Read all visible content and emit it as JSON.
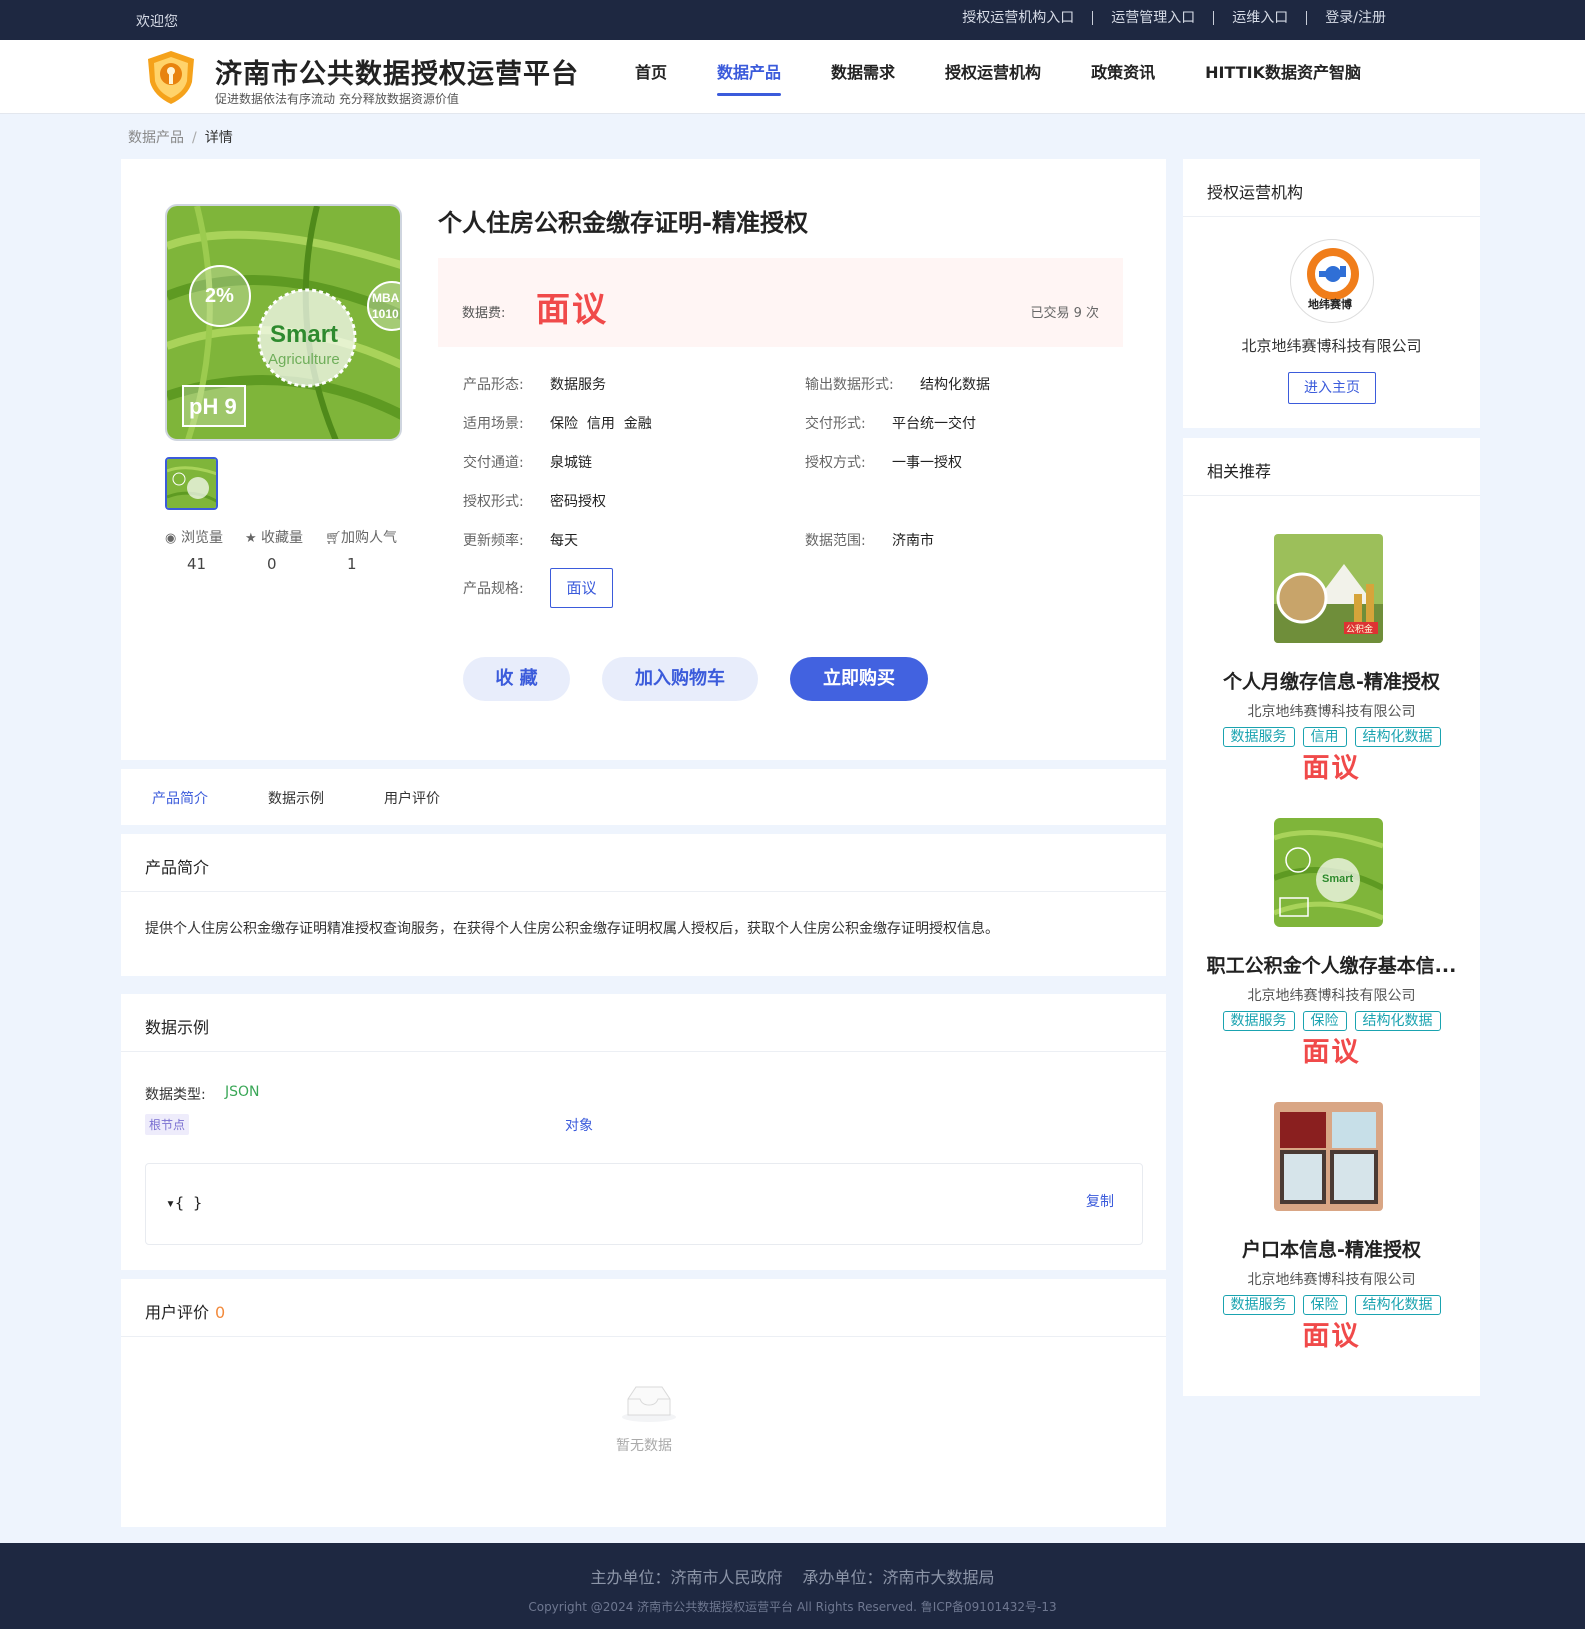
{
  "topbar": {
    "welcome": "欢迎您",
    "links": [
      "授权运营机构入口",
      "运营管理入口",
      "运维入口",
      "登录/注册"
    ]
  },
  "header": {
    "title": "济南市公共数据授权运营平台",
    "slogan": "促进数据依法有序流动 充分释放数据资源价值",
    "nav": [
      "首页",
      "数据产品",
      "数据需求",
      "授权运营机构",
      "政策资讯",
      "HITTIK数据资产智脑"
    ],
    "active_nav": "数据产品"
  },
  "breadcrumb": {
    "parent": "数据产品",
    "sep": "/",
    "current": "详情"
  },
  "product": {
    "title": "个人住房公积金缴存证明-精准授权",
    "image_labels": {
      "pct": "2%",
      "smart": "Smart",
      "agri": "Agriculture",
      "ph": "pH 9",
      "mba": "MBA",
      "num": "1010"
    },
    "price_label": "数据费:",
    "price": "面议",
    "trade_count": "已交易 9 次",
    "stats": [
      {
        "label": "浏览量",
        "value": "41"
      },
      {
        "label": "收藏量",
        "value": "0"
      },
      {
        "label": "加购人气",
        "value": "1"
      }
    ],
    "attrs": {
      "form_label": "产品形态:",
      "form": "数据服务",
      "output_label": "输出数据形式:",
      "output": "结构化数据",
      "scene_label": "适用场景:",
      "scene": "保险  信用  金融",
      "delivery_label": "交付形式:",
      "delivery": "平台统一交付",
      "channel_label": "交付通道:",
      "channel": "泉城链",
      "auth_label": "授权方式:",
      "auth": "一事一授权",
      "authform_label": "授权形式:",
      "authform": "密码授权",
      "freq_label": "更新频率:",
      "freq": "每天",
      "range_label": "数据范围:",
      "range": "济南市",
      "spec_label": "产品规格:",
      "spec": "面议"
    },
    "buttons": {
      "favorite": "收 藏",
      "cart": "加入购物车",
      "buy": "立即购买"
    }
  },
  "tabs": [
    "产品简介",
    "数据示例",
    "用户评价"
  ],
  "intro": {
    "title": "产品简介",
    "text": "提供个人住房公积金缴存证明精准授权查询服务，在获得个人住房公积金缴存证明权属人授权后，获取个人住房公积金缴存证明授权信息。"
  },
  "example": {
    "title": "数据示例",
    "type_label": "数据类型:",
    "type": "JSON",
    "root_tag": "根节点",
    "object_label": "对象",
    "json": "▾{ }",
    "copy": "复制"
  },
  "review": {
    "title": "用户评价",
    "count": "0",
    "empty": "暂无数据"
  },
  "org": {
    "title": "授权运营机构",
    "logo_text": "地纬赛博",
    "name": "北京地纬赛博科技有限公司",
    "button": "进入主页"
  },
  "recommend": {
    "title": "相关推荐",
    "items": [
      {
        "name": "个人月缴存信息-精准授权",
        "org": "北京地纬赛博科技有限公司",
        "tags": [
          "数据服务",
          "信用",
          "结构化数据"
        ],
        "price": "面议",
        "img_label": "公积金"
      },
      {
        "name": "职工公积金个人缴存基本信...",
        "org": "北京地纬赛博科技有限公司",
        "tags": [
          "数据服务",
          "保险",
          "结构化数据"
        ],
        "price": "面议",
        "img_label": "Smart"
      },
      {
        "name": "户口本信息-精准授权",
        "org": "北京地纬赛博科技有限公司",
        "tags": [
          "数据服务",
          "保险",
          "结构化数据"
        ],
        "price": "面议",
        "img_label": ""
      }
    ]
  },
  "footer": {
    "host": "主办单位：济南市人民政府",
    "organizer": "承办单位：济南市大数据局",
    "copyright": "Copyright @2024 济南市公共数据授权运营平台 All Rights Reserved. 鲁ICP备09101432号-13"
  },
  "colors": {
    "primary": "#3b5bdb",
    "price": "#f04a4a",
    "dark": "#1e2841",
    "tag": "#1aa3b0"
  }
}
